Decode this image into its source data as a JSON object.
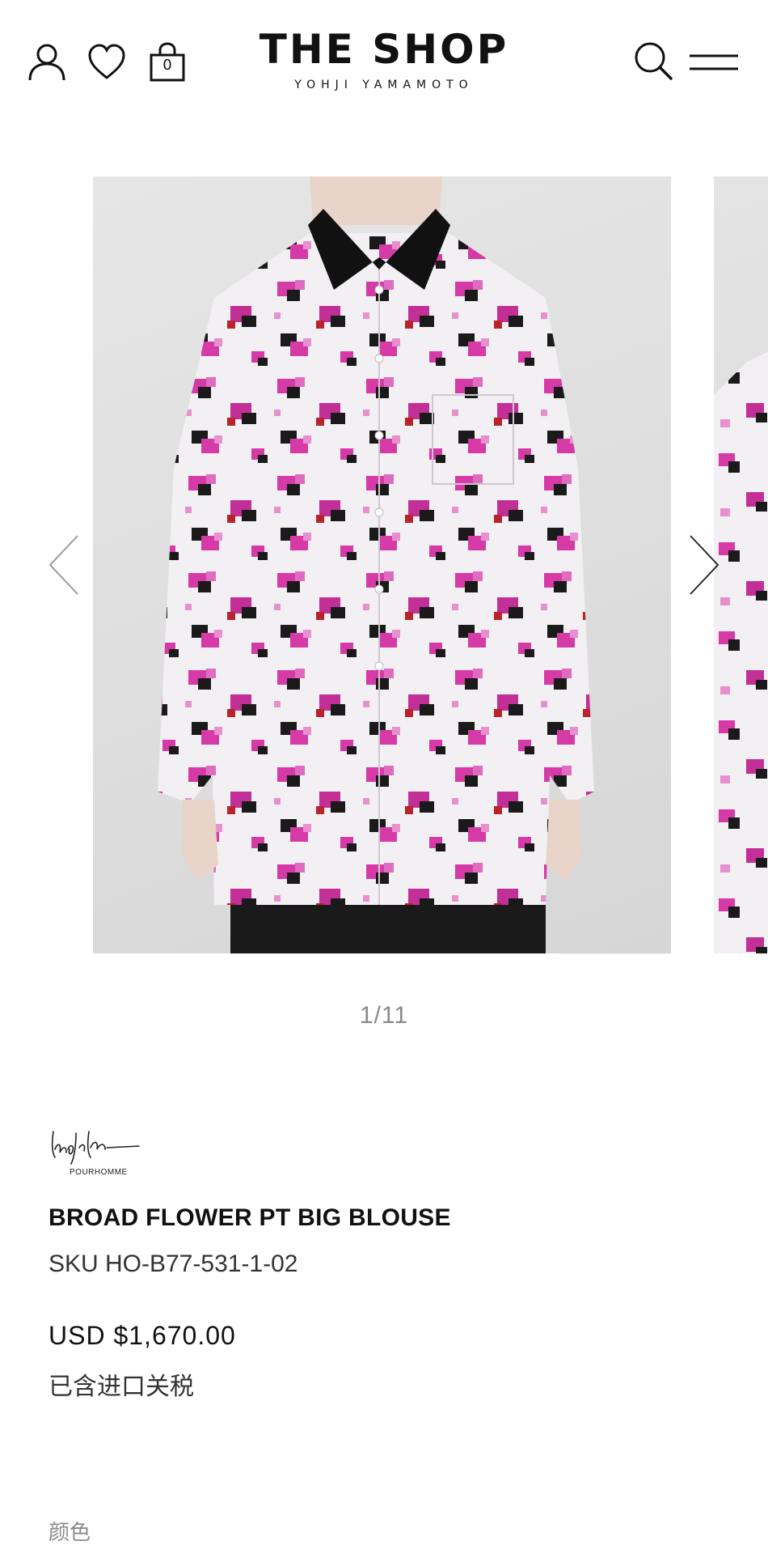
{
  "header": {
    "logo_main": "THE SHOP",
    "logo_sub": "YOHJI YAMAMOTO",
    "cart_count": "0",
    "icons": [
      "user-icon",
      "heart-icon",
      "bag-icon",
      "search-icon",
      "menu-icon"
    ]
  },
  "carousel": {
    "counter": "1/11",
    "icons": [
      "chevron-left-icon",
      "chevron-right-icon"
    ]
  },
  "product": {
    "brand_sub": "POURHOMME",
    "title": "BROAD FLOWER PT BIG BLOUSE",
    "sku": "SKU HO-B77-531-1-02",
    "price": "USD $1,670.00",
    "tax_note": "已含进口关税",
    "color_label": "颜色"
  },
  "colors": {
    "text": "#111111",
    "muted": "#8a8a8a",
    "print_pink": "#d63aa6",
    "print_black": "#1a1a1a"
  }
}
